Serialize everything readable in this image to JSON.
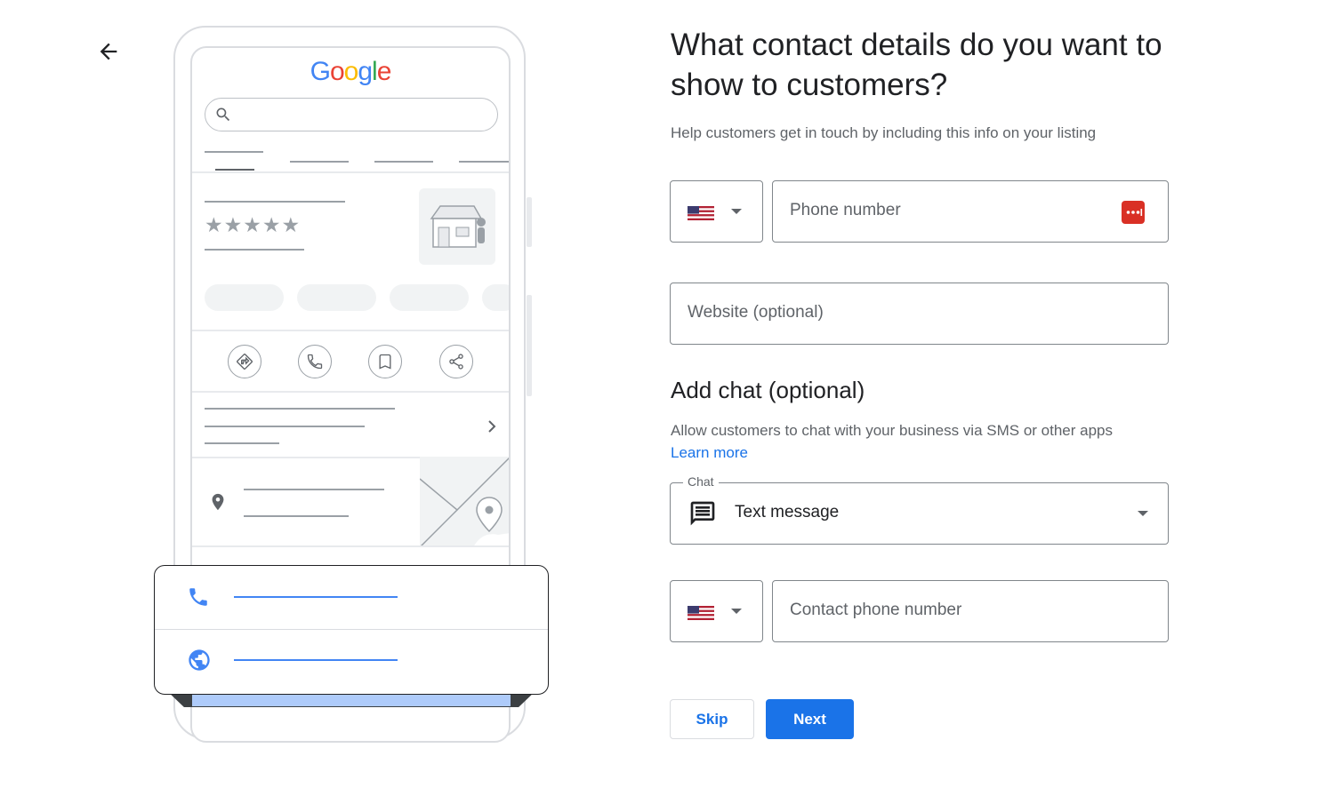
{
  "illustration": {
    "logo_text": "Google"
  },
  "form": {
    "title": "What contact details do you want to show to customers?",
    "subtitle": "Help customers get in touch by including this info on your listing",
    "phone": {
      "country_flag": "us-flag-icon",
      "placeholder": "Phone number"
    },
    "website": {
      "placeholder": "Website (optional)"
    },
    "chat_section": {
      "heading": "Add chat (optional)",
      "description": "Allow customers to chat with your business via SMS or other apps",
      "learn_more": "Learn more",
      "dropdown_label": "Chat",
      "dropdown_value": "Text message",
      "contact_phone_placeholder": "Contact phone number"
    },
    "buttons": {
      "skip": "Skip",
      "next": "Next"
    }
  },
  "colors": {
    "primary": "#1a73e8",
    "text": "#202124",
    "secondary_text": "#5f6368",
    "border": "#80868b"
  }
}
